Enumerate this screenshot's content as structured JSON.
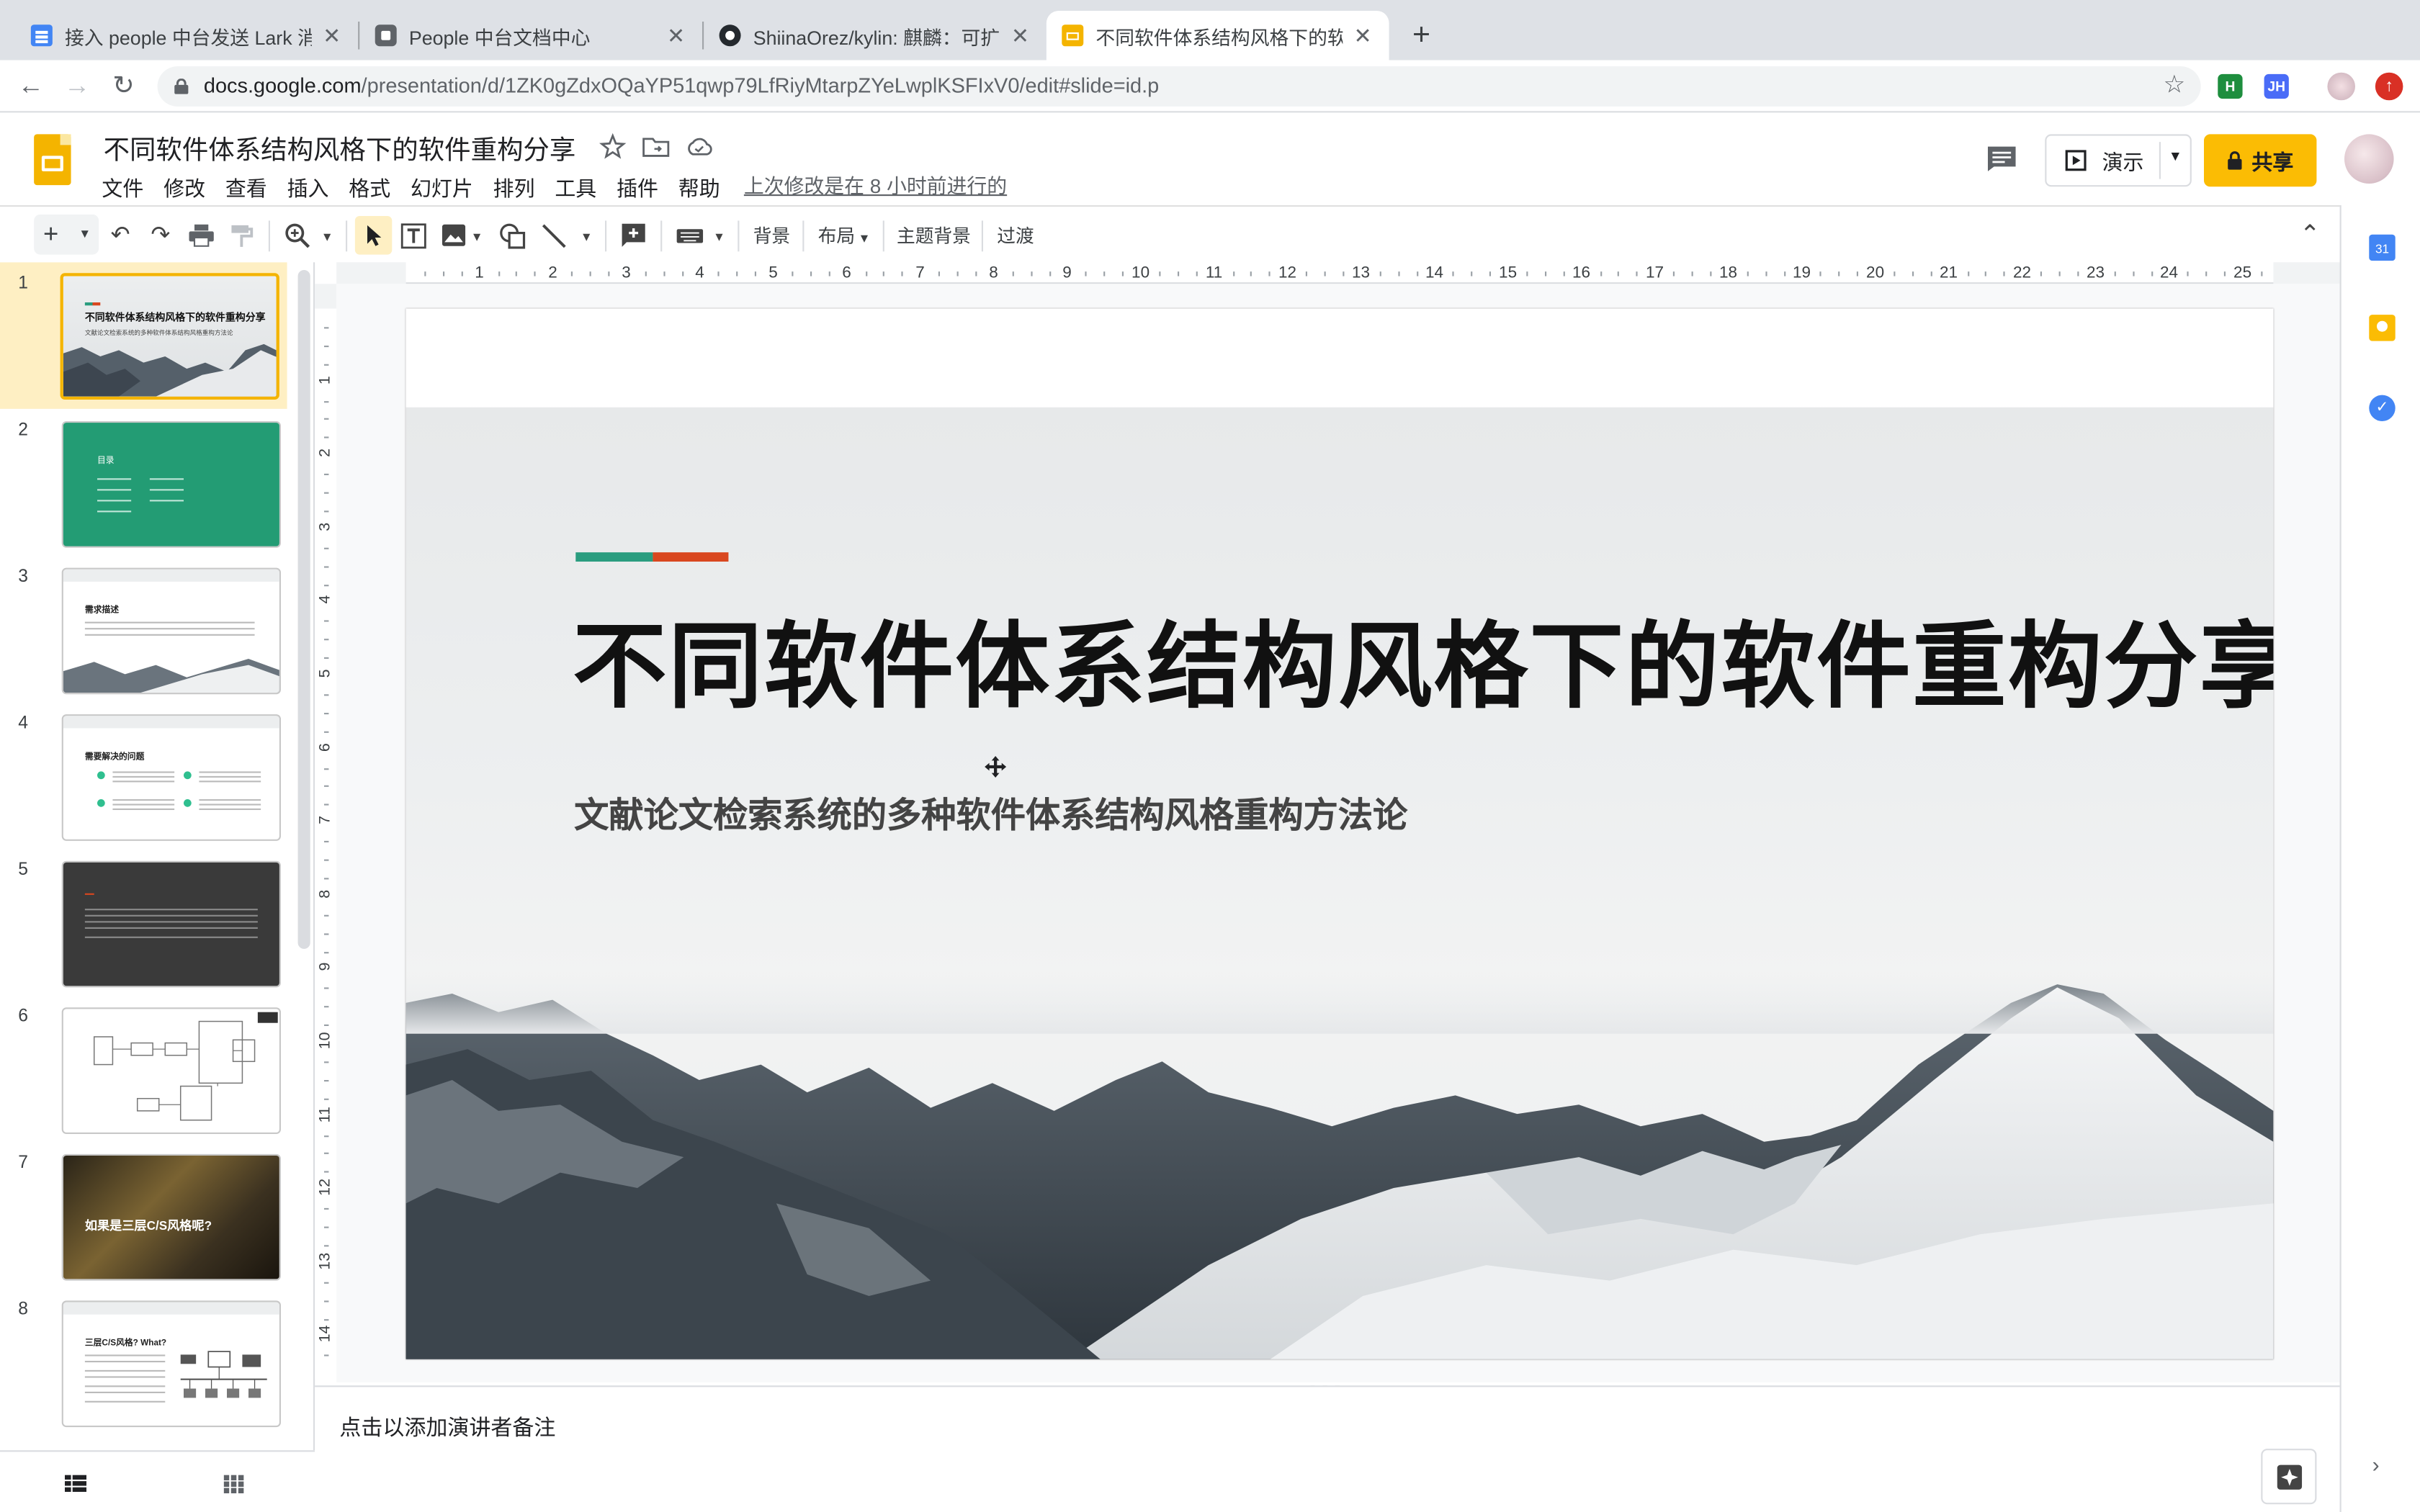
{
  "browser": {
    "tabs": [
      {
        "title": "接入 people 中台发送 Lark 消息",
        "icon": "google-docs-icon"
      },
      {
        "title": "People 中台文档中心",
        "icon": "page-icon"
      },
      {
        "title": "ShiinaOrez/kylin: 麒麟：可扩展",
        "icon": "github-icon"
      },
      {
        "title": "不同软件体系结构风格下的软件",
        "icon": "google-slides-icon"
      }
    ],
    "new_tab": "+",
    "url_host": "docs.google.com",
    "url_path": "/presentation/d/1ZK0gZdxOQaYP51qwp79LfRiyMtarpZYeLwplKSFIxV0/edit#slide=id.p",
    "extensions": [
      {
        "label": "H",
        "color": "#1e8e3e"
      },
      {
        "label": "JH",
        "color": "#4a6cf7"
      }
    ]
  },
  "app": {
    "doc_title": "不同软件体系结构风格下的软件重构分享",
    "menus": [
      "文件",
      "修改",
      "查看",
      "插入",
      "格式",
      "幻灯片",
      "排列",
      "工具",
      "插件",
      "帮助"
    ],
    "last_edit": "上次修改是在 8 小时前进行的",
    "present_label": "演示",
    "share_label": "共享",
    "accent_color": "#fbbc04"
  },
  "toolbar": {
    "background": "背景",
    "layout": "布局",
    "theme": "主题背景",
    "transition": "过渡"
  },
  "ruler": {
    "h_numbers": [
      "1",
      "2",
      "3",
      "4",
      "5",
      "6",
      "7",
      "8",
      "9",
      "10",
      "11",
      "12",
      "13",
      "14",
      "15",
      "16",
      "17",
      "18",
      "19",
      "20",
      "21",
      "22",
      "23",
      "24",
      "25"
    ],
    "v_numbers": [
      "1",
      "2",
      "3",
      "4",
      "5",
      "6",
      "7",
      "8",
      "9",
      "10",
      "11",
      "12",
      "13",
      "14"
    ]
  },
  "filmstrip": {
    "slides": [
      {
        "num": "1",
        "kind": "title",
        "title": "不同软件体系结构风格下的软件重构分享",
        "subtitle": "文献论文检索系统的多种软件体系结构风格重构方法论"
      },
      {
        "num": "2",
        "kind": "toc",
        "title": "目录"
      },
      {
        "num": "3",
        "kind": "section",
        "title": "需求描述"
      },
      {
        "num": "4",
        "kind": "list",
        "title": "需要解决的问题"
      },
      {
        "num": "5",
        "kind": "dark",
        "title": ""
      },
      {
        "num": "6",
        "kind": "diagram",
        "title": ""
      },
      {
        "num": "7",
        "kind": "photo",
        "title": "如果是三层C/S风格呢?"
      },
      {
        "num": "8",
        "kind": "diagram2",
        "title": "三层C/S风格? What?"
      }
    ]
  },
  "slide": {
    "title": "不同软件体系结构风格下的软件重构分享",
    "subtitle": "文献论文检索系统的多种软件体系结构风格重构方法论",
    "accent_colors": [
      "#2a9d7f",
      "#d9471f"
    ]
  },
  "notes": {
    "placeholder": "点击以添加演讲者备注"
  }
}
